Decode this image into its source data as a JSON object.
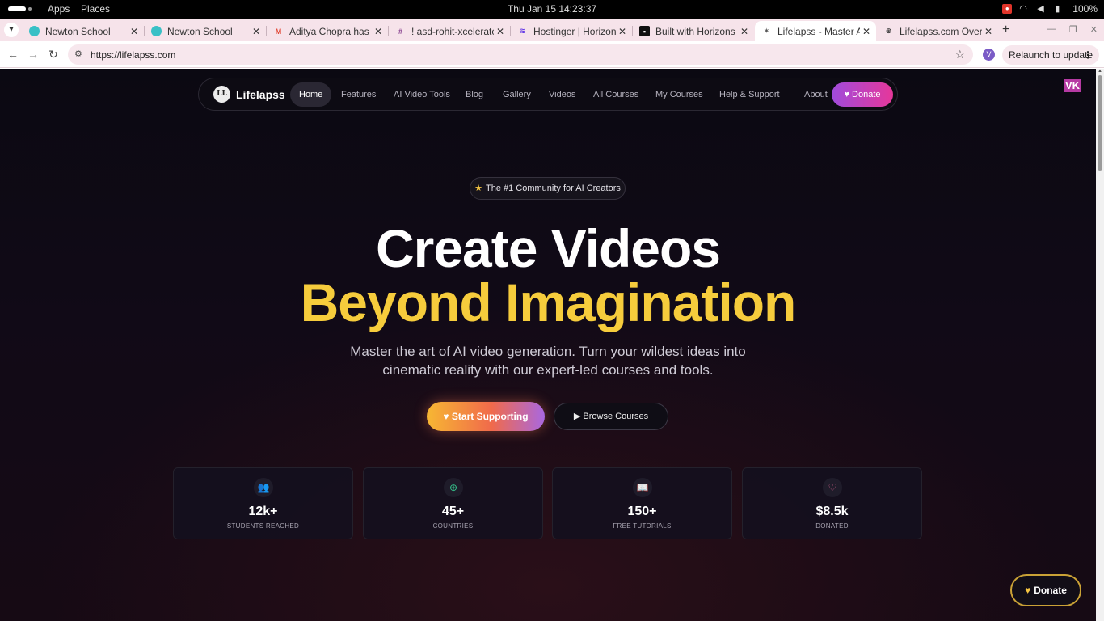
{
  "os": {
    "apps": "Apps",
    "places": "Places",
    "clock": "Thu Jan 15  14:23:37",
    "battery": "100%"
  },
  "tabs": [
    {
      "title": "Newton School",
      "favicon": "newton-icon",
      "color": "#39c0c6"
    },
    {
      "title": "Newton School",
      "favicon": "newton-icon",
      "color": "#39c0c6"
    },
    {
      "title": "Aditya Chopra has inv",
      "favicon": "gmail-icon",
      "color": "#e24c3c"
    },
    {
      "title": "! asd-rohit-xcelerate-",
      "favicon": "slack-icon",
      "color": "#7c3085"
    },
    {
      "title": "Hostinger | Horizons",
      "favicon": "hostinger-icon",
      "color": "#673de6"
    },
    {
      "title": "Built with Horizons",
      "favicon": "horizons-icon",
      "color": "#111111"
    },
    {
      "title": "Lifelapss - Master AI",
      "favicon": "lifelapss-icon",
      "color": "#555555",
      "active": true
    },
    {
      "title": "Lifelapss.com Overvi",
      "favicon": "chatgpt-icon",
      "color": "#333333"
    }
  ],
  "address": {
    "url": "https://lifelapss.com",
    "profile": "V",
    "relaunch": "Relaunch to update"
  },
  "site": {
    "brand": "Lifelapss",
    "logo_text": "LL",
    "nav": [
      "Home",
      "Features",
      "AI Video Tools",
      "Blog",
      "Gallery",
      "Videos",
      "All Courses",
      "My Courses",
      "Help & Support",
      "About"
    ],
    "nav_donate": "Donate",
    "avatar": "VK",
    "badge": "The #1 Community for AI Creators",
    "headline_1": "Create Videos",
    "headline_2": "Beyond Imagination",
    "subtitle_1": "Master the art of AI video generation. Turn your wildest ideas into",
    "subtitle_2": "cinematic reality with our expert-led courses and tools.",
    "cta_primary": "Start Supporting",
    "cta_secondary": "Browse Courses",
    "stats": [
      {
        "value": "12k+",
        "label": "STUDENTS REACHED",
        "icon": "users-icon",
        "color": "#7b8cf0"
      },
      {
        "value": "45+",
        "label": "COUNTRIES",
        "icon": "globe-icon",
        "color": "#36c98f"
      },
      {
        "value": "150+",
        "label": "FREE TUTORIALS",
        "icon": "book-icon",
        "color": "#b77ef0"
      },
      {
        "value": "$8.5k",
        "label": "DONATED",
        "icon": "heart-icon",
        "color": "#f06a9a"
      }
    ],
    "float_donate": "Donate",
    "accent_yellow": "#f6cc3c",
    "accent_pink": "#e6379a"
  }
}
